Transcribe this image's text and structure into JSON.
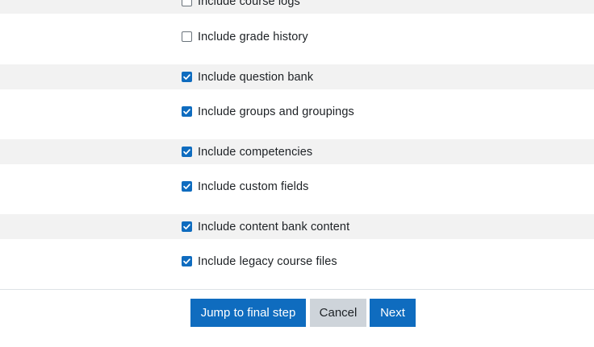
{
  "options": [
    {
      "label": "Include course logs",
      "checked": false
    },
    {
      "label": "Include grade history",
      "checked": false
    },
    {
      "label": "Include question bank",
      "checked": true
    },
    {
      "label": "Include groups and groupings",
      "checked": true
    },
    {
      "label": "Include competencies",
      "checked": true
    },
    {
      "label": "Include custom fields",
      "checked": true
    },
    {
      "label": "Include content bank content",
      "checked": true
    },
    {
      "label": "Include legacy course files",
      "checked": true
    }
  ],
  "buttons": {
    "jump_label": "Jump to final step",
    "cancel_label": "Cancel",
    "next_label": "Next"
  },
  "colors": {
    "accent": "#0f6cbf",
    "row_alt": "#f2f2f2",
    "secondary_button": "#ced4da"
  },
  "icons": {
    "checkbox_checked": "checkmark-icon"
  }
}
